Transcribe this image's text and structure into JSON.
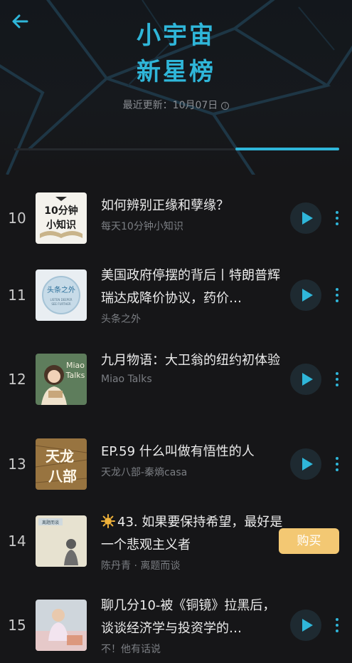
{
  "header": {
    "title_line1": "小宇宙",
    "title_line2": "新星榜",
    "update_text": "最近更新：10月07日",
    "accent_color": "#2fb6d9"
  },
  "icons": {
    "back": "arrow-left-icon",
    "info": "info-circle-icon",
    "play": "play-icon",
    "more": "more-vertical-icon",
    "paid": "sun-icon"
  },
  "items": [
    {
      "rank": "10",
      "title": "如何辨别正缘和孽缘？",
      "subtitle": "每天10分钟小知识",
      "action": "play",
      "cover_text": [
        "10分钟",
        "小知识"
      ]
    },
    {
      "rank": "11",
      "title": "美国政府停摆的背后丨特朗普辉瑞达成降价协议，药价…",
      "subtitle": "头条之外",
      "action": "play",
      "cover_text": [
        "头条之外",
        "LISTEN DEEPER",
        "SEE FURTHER"
      ]
    },
    {
      "rank": "12",
      "title": "九月物语：大卫翁的纽约初体验",
      "subtitle": "Miao Talks",
      "action": "play",
      "cover_text": [
        "Miao",
        "Talks"
      ]
    },
    {
      "rank": "13",
      "title": "EP.59 什么叫做有悟性的人",
      "subtitle": "天龙八部-秦熵casa",
      "action": "play",
      "cover_text": [
        "天龙",
        "八部"
      ]
    },
    {
      "rank": "14",
      "title": "43. 如果要保持希望，最好是一个悲观主义者",
      "subtitle": "陈丹青 · 离题而谈",
      "action": "buy",
      "buy_label": "购买",
      "cover_text": [
        "离题而谈"
      ]
    },
    {
      "rank": "15",
      "title": "聊几分10-被《铜镜》拉黑后，谈谈经济学与投资学的…",
      "subtitle": "不！他有话说",
      "action": "play",
      "cover_text": []
    }
  ]
}
